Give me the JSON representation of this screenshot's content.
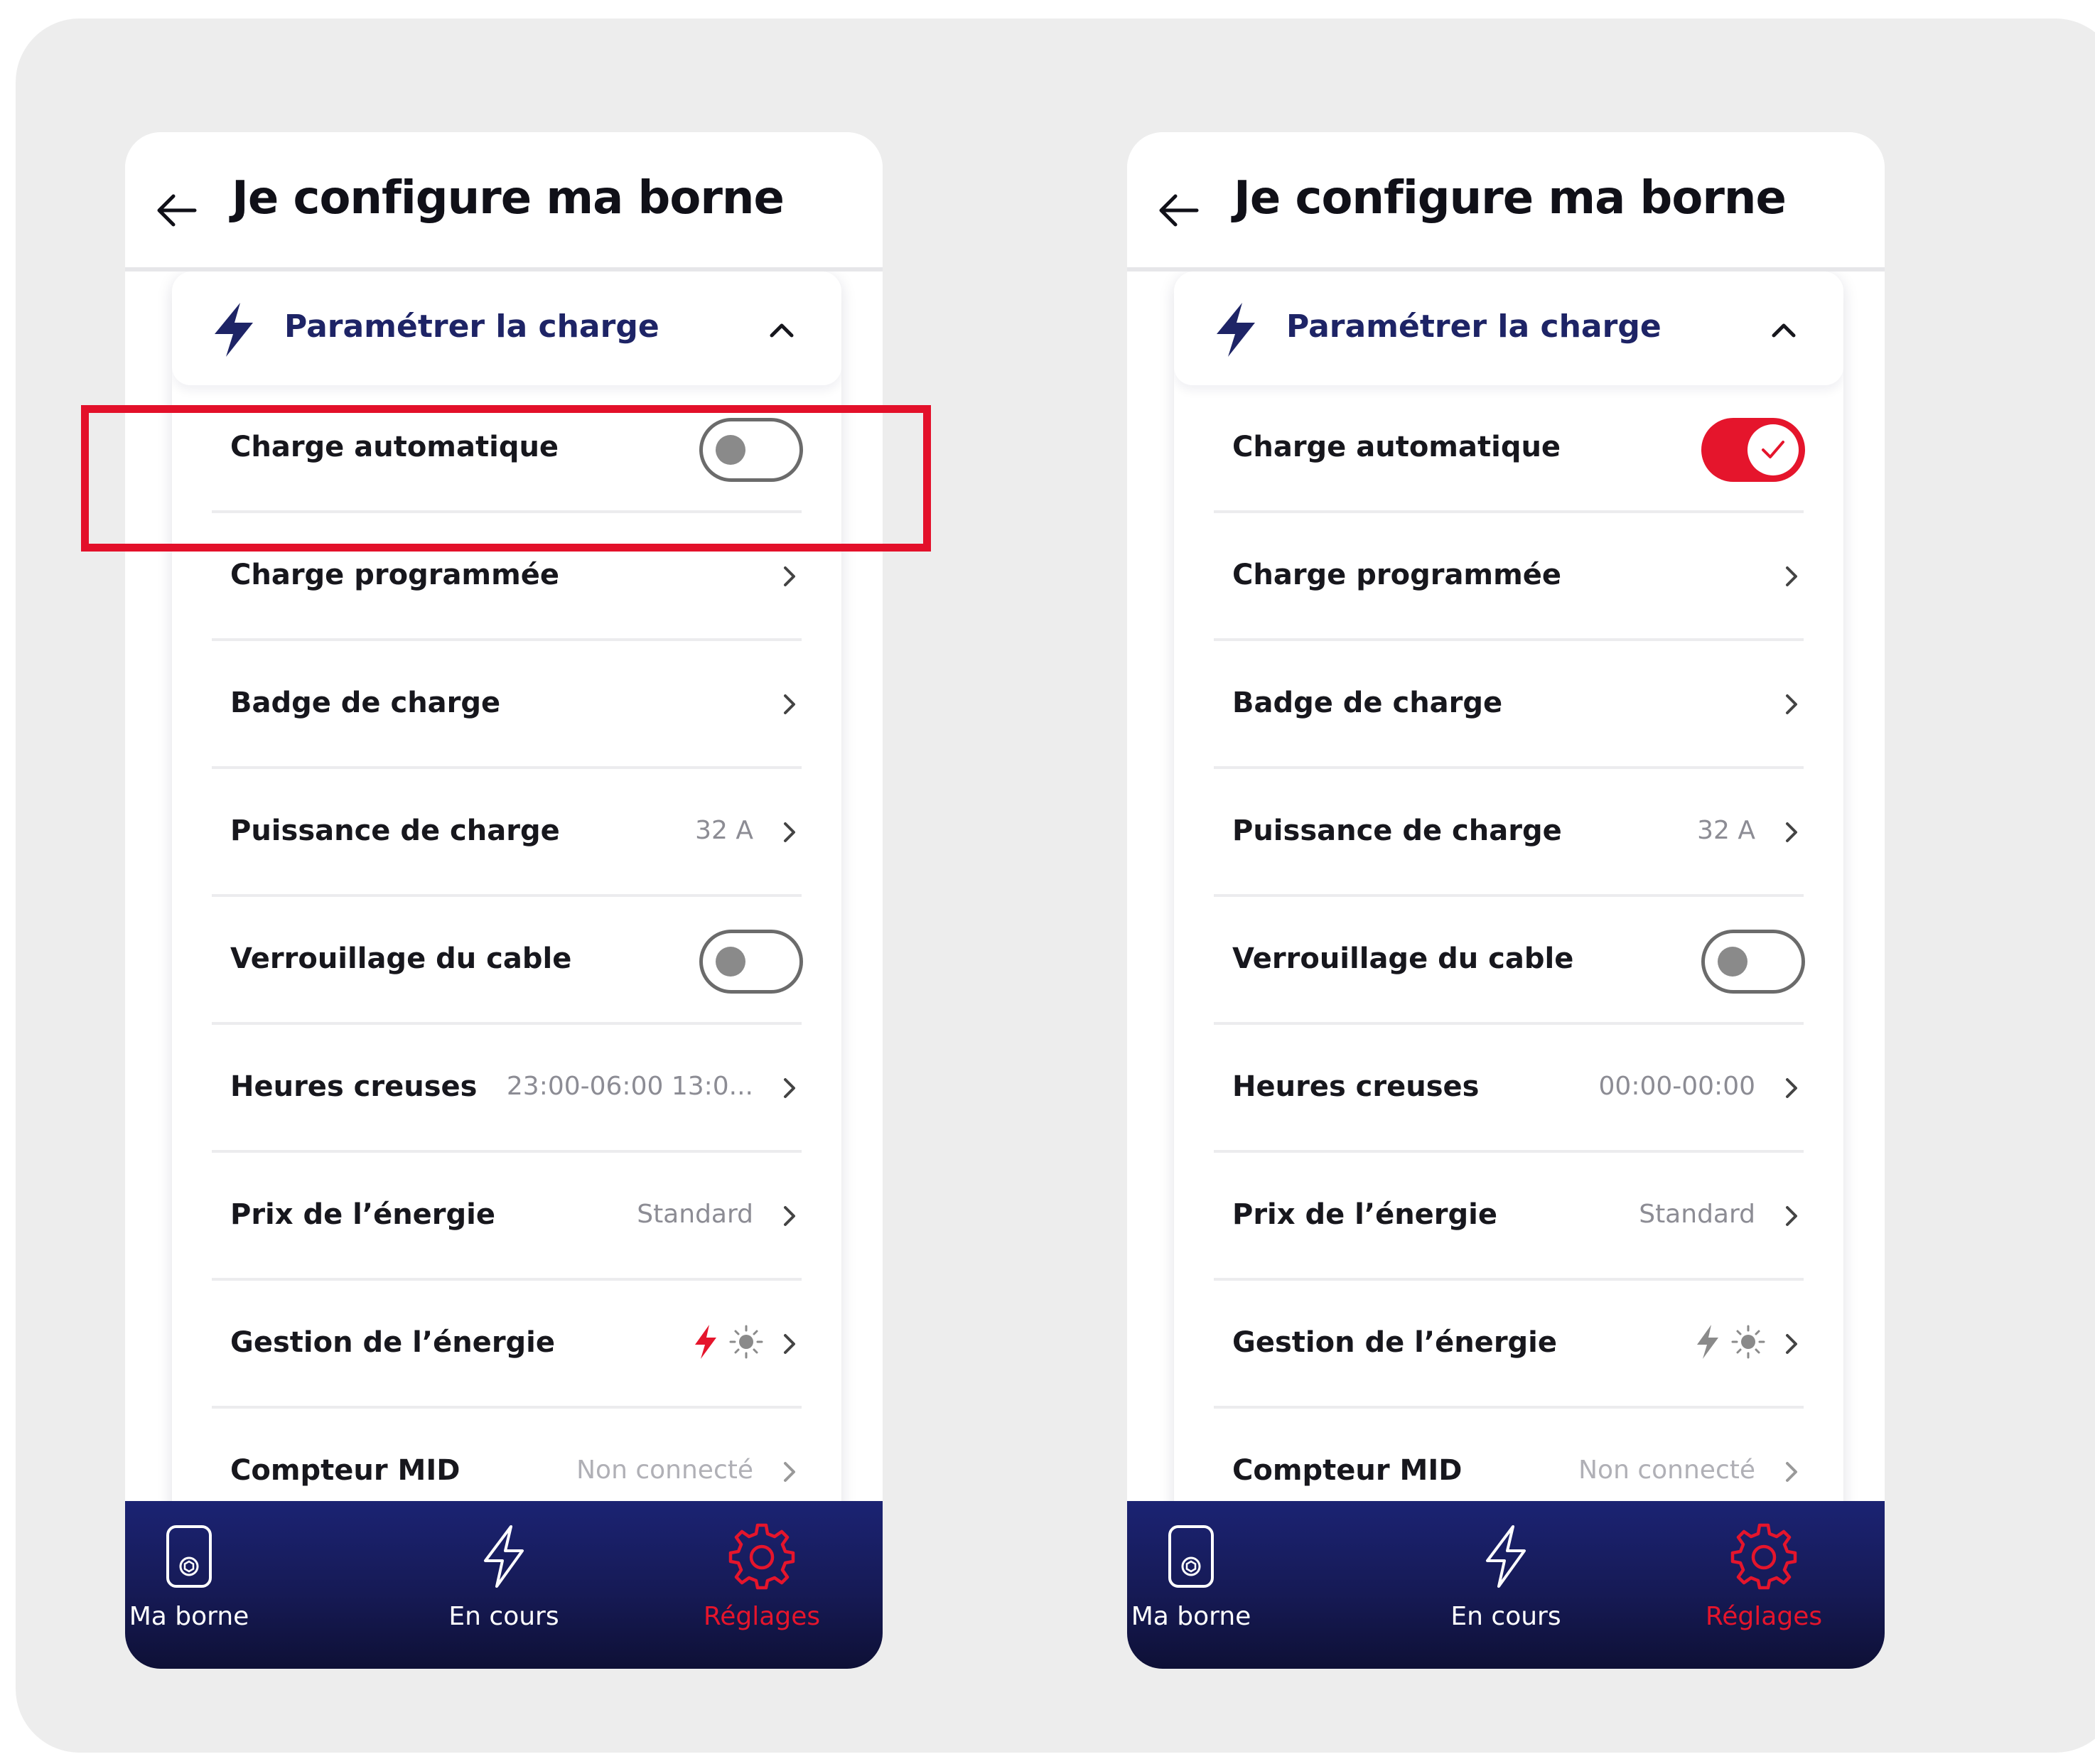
{
  "header": {
    "title": "Je configure ma borne"
  },
  "section": {
    "title": "Paramétrer la charge"
  },
  "rows": {
    "auto": "Charge automatique",
    "scheduled": "Charge programmée",
    "badge": "Badge de charge",
    "power": "Puissance de charge",
    "lock": "Verrouillage du cable",
    "offpeak": "Heures creuses",
    "price": "Prix de l’énergie",
    "management": "Gestion de l’énergie",
    "mid": "Compteur MID"
  },
  "left": {
    "auto_charge_on": false,
    "power_value": "32 A",
    "cable_lock_on": false,
    "offpeak_value": "23:00-06:00 13:0...",
    "price_value": "Standard",
    "mid_value": "Non connecté",
    "grid_mode_active": true
  },
  "right": {
    "auto_charge_on": true,
    "power_value": "32 A",
    "cable_lock_on": false,
    "offpeak_value": "00:00-00:00",
    "price_value": "Standard",
    "mid_value": "Non connecté",
    "grid_mode_active": false
  },
  "nav": {
    "home": "Ma borne",
    "current": "En cours",
    "settings": "Réglages",
    "active_item": "settings"
  },
  "colors": {
    "accent_red": "#e5152c",
    "navy": "#1e2466",
    "nav_background": "#161a55",
    "highlight_box": "#e3102a"
  },
  "icons": {
    "back": "arrow-left-icon",
    "section": "lightning-bolt-icon",
    "collapse": "chevron-up-icon",
    "row_chevron": "chevron-right-icon",
    "grid_energy": "lightning-bolt-icon",
    "solar_energy": "sun-icon",
    "nav_home": "charger-station-icon",
    "nav_current": "lightning-outline-icon",
    "nav_settings": "gear-icon",
    "toggle_check": "checkmark-icon"
  }
}
